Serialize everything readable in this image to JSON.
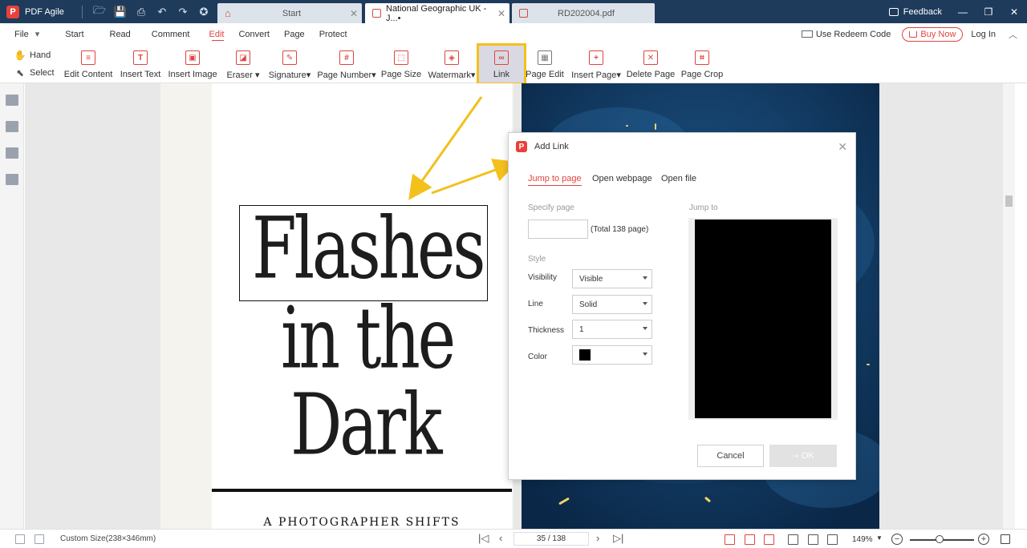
{
  "app": {
    "name": "PDF Agile",
    "logo_letter": "P"
  },
  "tabs": [
    {
      "label": "Start"
    },
    {
      "label": "National Geographic UK - J...•"
    },
    {
      "label": "RD202004.pdf"
    }
  ],
  "titlebar": {
    "feedback": "Feedback"
  },
  "menu": {
    "items": [
      "File",
      "Start",
      "Read",
      "Comment",
      "Edit",
      "Convert",
      "Page",
      "Protect"
    ],
    "active": "Edit",
    "redeem": "Use Redeem Code",
    "buy_now": "Buy Now",
    "login": "Log In"
  },
  "toolbar": {
    "hand": "Hand",
    "select": "Select",
    "tools": [
      "Edit Content",
      "Insert Text",
      "Insert Image",
      "Eraser ▾",
      "Signature▾",
      "Page Number▾",
      "Page Size",
      "Watermark▾",
      "Link",
      "Page Edit",
      "Insert Page▾",
      "Delete Page",
      "Page Crop"
    ],
    "highlight_color": "#f3c01c"
  },
  "document": {
    "title_lines": [
      "Flashes",
      "in the",
      "Dark"
    ],
    "subtitle": "A PHOTOGRAPHER SHIFTS"
  },
  "dialog": {
    "title": "Add Link",
    "tabs": [
      "Jump to page",
      "Open webpage",
      "Open file"
    ],
    "active_tab": "Jump to page",
    "specify_page_label": "Specify page",
    "page_value": "",
    "total_pages": "(Total 138 page)",
    "jump_to_label": "Jump to",
    "style_label": "Style",
    "visibility_label": "Visibility",
    "visibility_value": "Visible",
    "line_label": "Line",
    "line_value": "Solid",
    "thickness_label": "Thickness",
    "thickness_value": "1",
    "color_label": "Color",
    "color_value": "#000000",
    "cancel": "Cancel",
    "ok": "OK"
  },
  "status": {
    "page_size": "Custom Size(238×346mm)",
    "current_page": "35 / 138",
    "zoom": "149%",
    "zoom_level": 0.46
  },
  "colors": {
    "titlebar": "#1f3b5c",
    "accent": "#e0443f"
  }
}
